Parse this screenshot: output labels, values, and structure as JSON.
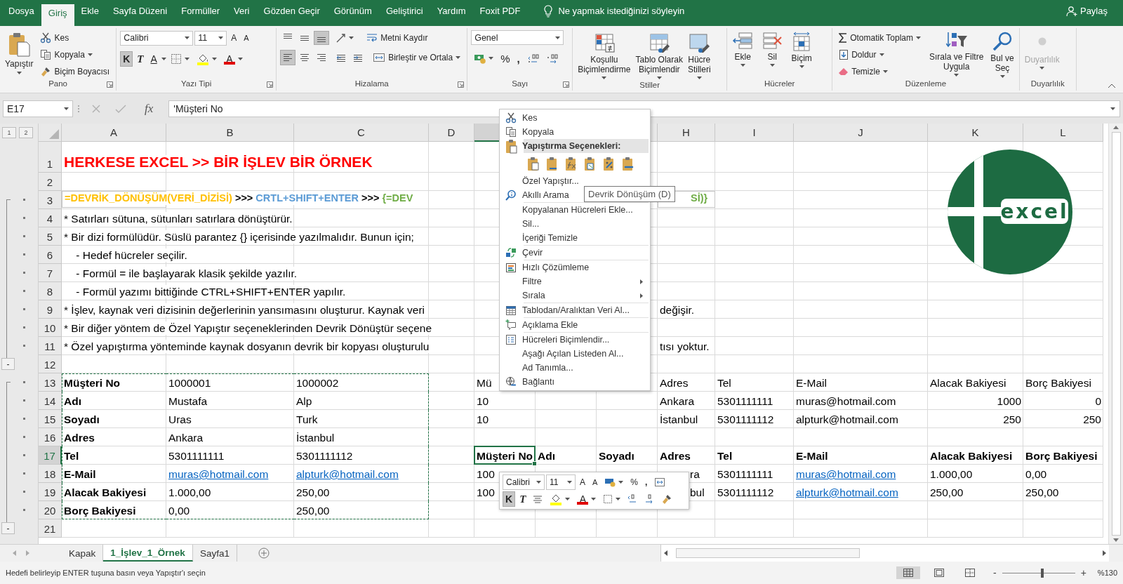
{
  "tabs": [
    {
      "label": "Dosya",
      "selected": false
    },
    {
      "label": "Giriş",
      "selected": true
    },
    {
      "label": "Ekle",
      "selected": false
    },
    {
      "label": "Sayfa Düzeni",
      "selected": false
    },
    {
      "label": "Formüller",
      "selected": false
    },
    {
      "label": "Veri",
      "selected": false
    },
    {
      "label": "Gözden Geçir",
      "selected": false
    },
    {
      "label": "Görünüm",
      "selected": false
    },
    {
      "label": "Geliştirici",
      "selected": false
    },
    {
      "label": "Yardım",
      "selected": false
    },
    {
      "label": "Foxit PDF",
      "selected": false
    }
  ],
  "tell_me": "Ne yapmak istediğinizi söyleyin",
  "share": "Paylaş",
  "ribbon": {
    "clipboard": {
      "label": "Pano",
      "paste": "Yapıştır",
      "cut": "Kes",
      "copy": "Kopyala",
      "painter": "Biçim Boyacısı"
    },
    "font": {
      "label": "Yazı Tipi",
      "name": "Calibri",
      "size": "11",
      "grow": "A",
      "shrink": "A",
      "styles": [
        {
          "label": "K",
          "pressed": true
        },
        {
          "label": "T",
          "pressed": false
        },
        {
          "label": "A",
          "pressed": false
        }
      ],
      "font_color_letter": "A"
    },
    "alignment": {
      "label": "Hizalama",
      "vertical": [
        {
          "pressed": false
        },
        {
          "pressed": false
        },
        {
          "pressed": true
        }
      ],
      "horizontal": [
        {
          "pressed": true
        },
        {
          "pressed": false
        },
        {
          "pressed": false
        }
      ],
      "wrap": "Metni Kaydır",
      "merge": "Birleştir ve Ortala"
    },
    "number": {
      "label": "Sayı",
      "format": "Genel",
      "percent": "%",
      "comma": ","
    },
    "styles": {
      "label": "Stiller",
      "buttons": [
        {
          "lines": [
            "Koşullu",
            "Biçimlendirme"
          ]
        },
        {
          "lines": [
            "Tablo Olarak",
            "Biçimlendir"
          ]
        },
        {
          "lines": [
            "Hücre",
            "Stilleri"
          ]
        }
      ]
    },
    "cells": {
      "label": "Hücreler",
      "buttons": [
        "Ekle",
        "Sil",
        "Biçim"
      ]
    },
    "editing": {
      "label": "Düzenleme",
      "items": [
        "Otomatik Toplam",
        "Doldur",
        "Temizle"
      ],
      "buttons": [
        {
          "lines": [
            "Sırala ve Filtre",
            "Uygula"
          ]
        },
        {
          "lines": [
            "Bul ve",
            "Seç"
          ]
        }
      ]
    },
    "sensitivity": {
      "label": "Duyarlılık",
      "button": "Duyarlılık",
      "disabled": true
    }
  },
  "formula_bar": {
    "name_box": "E17",
    "fx": "fx",
    "formula": "'Müşteri No"
  },
  "outline": {
    "levels": [
      "1",
      "2"
    ]
  },
  "sheet": {
    "columns": [
      {
        "label": "A",
        "selected": false,
        "copied": true
      },
      {
        "label": "B",
        "selected": false,
        "copied": true
      },
      {
        "label": "C",
        "selected": false,
        "copied": true
      },
      {
        "label": "D",
        "selected": false
      },
      {
        "selected": true
      },
      null,
      {
        "selected": false
      },
      {
        "label": "H",
        "selected": false
      },
      {
        "label": "I",
        "selected": false
      },
      {
        "label": "J",
        "selected": false
      },
      {
        "label": "K",
        "selected": false
      },
      {
        "label": "L",
        "selected": false
      }
    ],
    "rows": [
      {
        "number": "1",
        "kind": "title",
        "selected": false,
        "cells": {
          "A": {
            "text": "HERKESE EXCEL >> BİR İŞLEV BİR ÖRNEK"
          }
        }
      },
      {
        "number": "2",
        "selected": false
      },
      {
        "number": "3",
        "kind": "formula",
        "selected": false,
        "grouped": true,
        "cells": {
          "A": {
            "segments": [
              {
                "text": "=DEVRİK_DÖNÜŞÜM(VERİ_DİZİSİ)",
                "color": "#ffc000"
              },
              {
                "text": " >>> ",
                "color": "#000000"
              },
              {
                "text": "CRTL+SHIFT+ENTER",
                "color": "#5b9bd5"
              },
              {
                "text": " >>> ",
                "color": "#000000"
              },
              {
                "text": "{=DEV",
                "color": "#70ad47"
              }
            ]
          },
          "H": {
            "segments": [
              {
                "text": "Sİ)}",
                "color": "#70ad47"
              }
            ]
          }
        }
      },
      {
        "number": "4",
        "selected": false,
        "grouped": true,
        "cells": {
          "A": {
            "text": "* Satırları sütuna, sütunları satırlara dönüştürür."
          }
        }
      },
      {
        "number": "5",
        "selected": false,
        "grouped": true,
        "cells": {
          "A": {
            "text": "* Bir dizi formülüdür. Süslü parantez {} içerisinde yazılmalıdır. Bunun için;"
          }
        }
      },
      {
        "number": "6",
        "selected": false,
        "grouped": true,
        "cells": {
          "A": {
            "text": "    - Hedef hücreler seçilir."
          }
        }
      },
      {
        "number": "7",
        "selected": false,
        "grouped": true,
        "cells": {
          "A": {
            "text": "    - Formül = ile başlayarak klasik şekilde yazılır."
          }
        }
      },
      {
        "number": "8",
        "selected": false,
        "grouped": true,
        "cells": {
          "A": {
            "text": "    - Formül yazımı bittiğinde CTRL+SHIFT+ENTER yapılır."
          }
        }
      },
      {
        "number": "9",
        "selected": false,
        "grouped": true,
        "cells": {
          "A": {
            "text": "* İşlev, kaynak veri dizisinin değerlerinin yansımasını oluşturur. Kaynak veri"
          },
          "H": {
            "text": "değişir."
          }
        }
      },
      {
        "number": "10",
        "selected": false,
        "grouped": true,
        "cells": {
          "A": {
            "text": "* Bir diğer yöntem de Özel Yapıştır seçeneklerinden Devrik Dönüştür seçene"
          }
        }
      },
      {
        "number": "11",
        "selected": false,
        "grouped": true,
        "cells": {
          "A": {
            "text": "* Özel yapıştırma yönteminde kaynak dosyanın devrik bir kopyası oluşturulu"
          },
          "H": {
            "text": "tısı yoktur."
          }
        }
      },
      {
        "number": "12",
        "selected": false,
        "collapse": "-"
      },
      {
        "number": "13",
        "selected": false,
        "grouped": true,
        "copied": true,
        "cells": {
          "A": {
            "text": "Müşteri No",
            "bold": true
          },
          "B": {
            "text": "1000001"
          },
          "C": {
            "text": "1000002"
          },
          "E": {
            "text": "Mü"
          },
          "H": {
            "text": "Adres"
          },
          "I": {
            "text": "Tel"
          },
          "J": {
            "text": "E-Mail"
          },
          "K": {
            "text": "Alacak Bakiyesi"
          },
          "L": {
            "text": "Borç Bakiyesi"
          }
        }
      },
      {
        "number": "14",
        "selected": false,
        "grouped": true,
        "copied": true,
        "cells": {
          "A": {
            "text": "Adı",
            "bold": true
          },
          "B": {
            "text": "Mustafa"
          },
          "C": {
            "text": "Alp"
          },
          "E": {
            "text": "10"
          },
          "H": {
            "text": "Ankara"
          },
          "I": {
            "text": "5301111111"
          },
          "J": {
            "text": "muras@hotmail.com"
          },
          "K": {
            "text": "1000",
            "right_aligned": true
          },
          "L": {
            "text": "0",
            "right_aligned": true
          }
        }
      },
      {
        "number": "15",
        "selected": false,
        "grouped": true,
        "copied": true,
        "cells": {
          "A": {
            "text": "Soyadı",
            "bold": true
          },
          "B": {
            "text": "Uras"
          },
          "C": {
            "text": "Turk"
          },
          "E": {
            "text": "10"
          },
          "H": {
            "text": "İstanbul"
          },
          "I": {
            "text": "5301111112"
          },
          "J": {
            "text": "alpturk@hotmail.com"
          },
          "K": {
            "text": "250",
            "right_aligned": true
          },
          "L": {
            "text": "250",
            "right_aligned": true
          }
        }
      },
      {
        "number": "16",
        "selected": false,
        "grouped": true,
        "copied": true,
        "cells": {
          "A": {
            "text": "Adres",
            "bold": true
          },
          "B": {
            "text": "Ankara"
          },
          "C": {
            "text": "İstanbul"
          }
        }
      },
      {
        "number": "17",
        "selected": true,
        "grouped": true,
        "copied": true,
        "cells": {
          "A": {
            "text": "Tel",
            "bold": true
          },
          "B": {
            "text": "5301111111"
          },
          "C": {
            "text": "5301111112"
          },
          "E": {
            "text": "Müşteri No",
            "bold": true
          },
          "F": {
            "text": "Adı",
            "bold": true
          },
          "G": {
            "text": "Soyadı",
            "bold": true
          },
          "H": {
            "text": "Adres",
            "bold": true
          },
          "I": {
            "text": "Tel",
            "bold": true
          },
          "J": {
            "text": "E-Mail",
            "bold": true
          },
          "K": {
            "text": "Alacak Bakiyesi",
            "bold": true
          },
          "L": {
            "text": "Borç Bakiyesi",
            "bold": true
          }
        }
      },
      {
        "number": "18",
        "selected": false,
        "grouped": true,
        "copied": true,
        "cells": {
          "A": {
            "text": "E-Mail",
            "bold": true
          },
          "B": {
            "text": "muras@hotmail.com",
            "link": true
          },
          "C": {
            "text": "alpturk@hotmail.com",
            "link": true
          },
          "E": {
            "text": "100"
          },
          "H": {
            "text": "ra"
          },
          "I": {
            "text": "5301111111"
          },
          "J": {
            "text": "muras@hotmail.com",
            "link": true
          },
          "K": {
            "text": "1.000,00"
          },
          "L": {
            "text": "0,00"
          }
        }
      },
      {
        "number": "19",
        "selected": false,
        "grouped": true,
        "copied": true,
        "cells": {
          "A": {
            "text": "Alacak Bakiyesi",
            "bold": true
          },
          "B": {
            "text": "1.000,00"
          },
          "C": {
            "text": "250,00"
          },
          "E": {
            "text": "100"
          },
          "H": {
            "text": "bul"
          },
          "I": {
            "text": "5301111112"
          },
          "J": {
            "text": "alpturk@hotmail.com",
            "link": true
          },
          "K": {
            "text": "250,00"
          },
          "L": {
            "text": "250,00"
          }
        }
      },
      {
        "number": "20",
        "selected": false,
        "grouped": true,
        "copied": true,
        "cells": {
          "A": {
            "text": "Borç Bakiyesi",
            "bold": true
          },
          "B": {
            "text": "0,00"
          },
          "C": {
            "text": "250,00"
          }
        }
      },
      {
        "number": "21",
        "selected": false,
        "collapse": "-"
      }
    ],
    "logo": {
      "text": "excel"
    }
  },
  "context_menu": {
    "items": [
      {
        "kind": "item",
        "label": "Kes"
      },
      {
        "kind": "item",
        "label": "Kopyala"
      },
      {
        "kind": "header",
        "label": "Yapıştırma Seçenekleri:"
      },
      {
        "kind": "paste_options"
      },
      {
        "kind": "item",
        "label": "Özel Yapıştır..."
      },
      {
        "kind": "item",
        "label": "Akıllı Arama"
      },
      {
        "kind": "separator"
      },
      {
        "kind": "item",
        "label": "Kopyalanan Hücreleri Ekle..."
      },
      {
        "kind": "item",
        "label": "Sil..."
      },
      {
        "kind": "item",
        "label": "İçeriği Temizle"
      },
      {
        "kind": "separator"
      },
      {
        "kind": "item",
        "label": "Çevir"
      },
      {
        "kind": "separator"
      },
      {
        "kind": "item",
        "label": "Hızlı Çözümleme"
      },
      {
        "kind": "submenu",
        "label": "Filtre"
      },
      {
        "kind": "submenu",
        "label": "Sırala"
      },
      {
        "kind": "separator"
      },
      {
        "kind": "item",
        "label": "Tablodan/Aralıktan Veri Al..."
      },
      {
        "kind": "separator"
      },
      {
        "kind": "item",
        "label": "Açıklama Ekle"
      },
      {
        "kind": "separator"
      },
      {
        "kind": "item",
        "label": "Hücreleri Biçimlendir..."
      },
      {
        "kind": "item",
        "label": "Aşağı Açılan Listeden Al..."
      },
      {
        "kind": "item",
        "label": "Ad Tanımla..."
      },
      {
        "kind": "item",
        "label": "Bağlantı"
      }
    ]
  },
  "tooltip": "Devrik Dönüşüm (D)",
  "mini_toolbar": {
    "font": "Calibri",
    "size": "11",
    "grow": "A",
    "shrink": "A",
    "percent": "%",
    "comma": ",",
    "styles": [
      {
        "label": "K",
        "pressed": true
      },
      {
        "label": "T",
        "pressed": false
      }
    ],
    "font_color_letter": "A"
  },
  "sheet_tabs": [
    {
      "label": "Kapak",
      "selected": false
    },
    {
      "label": "1_İşlev_1_Örnek",
      "selected": true
    },
    {
      "label": "Sayfa1",
      "selected": false
    }
  ],
  "status_bar": {
    "message": "Hedefi belirleyip ENTER tuşuna basın veya Yapıştır'ı seçin",
    "zoom_out": "-",
    "zoom_in": "+",
    "zoom": {
      "level": 0.55,
      "label": "%130"
    }
  }
}
